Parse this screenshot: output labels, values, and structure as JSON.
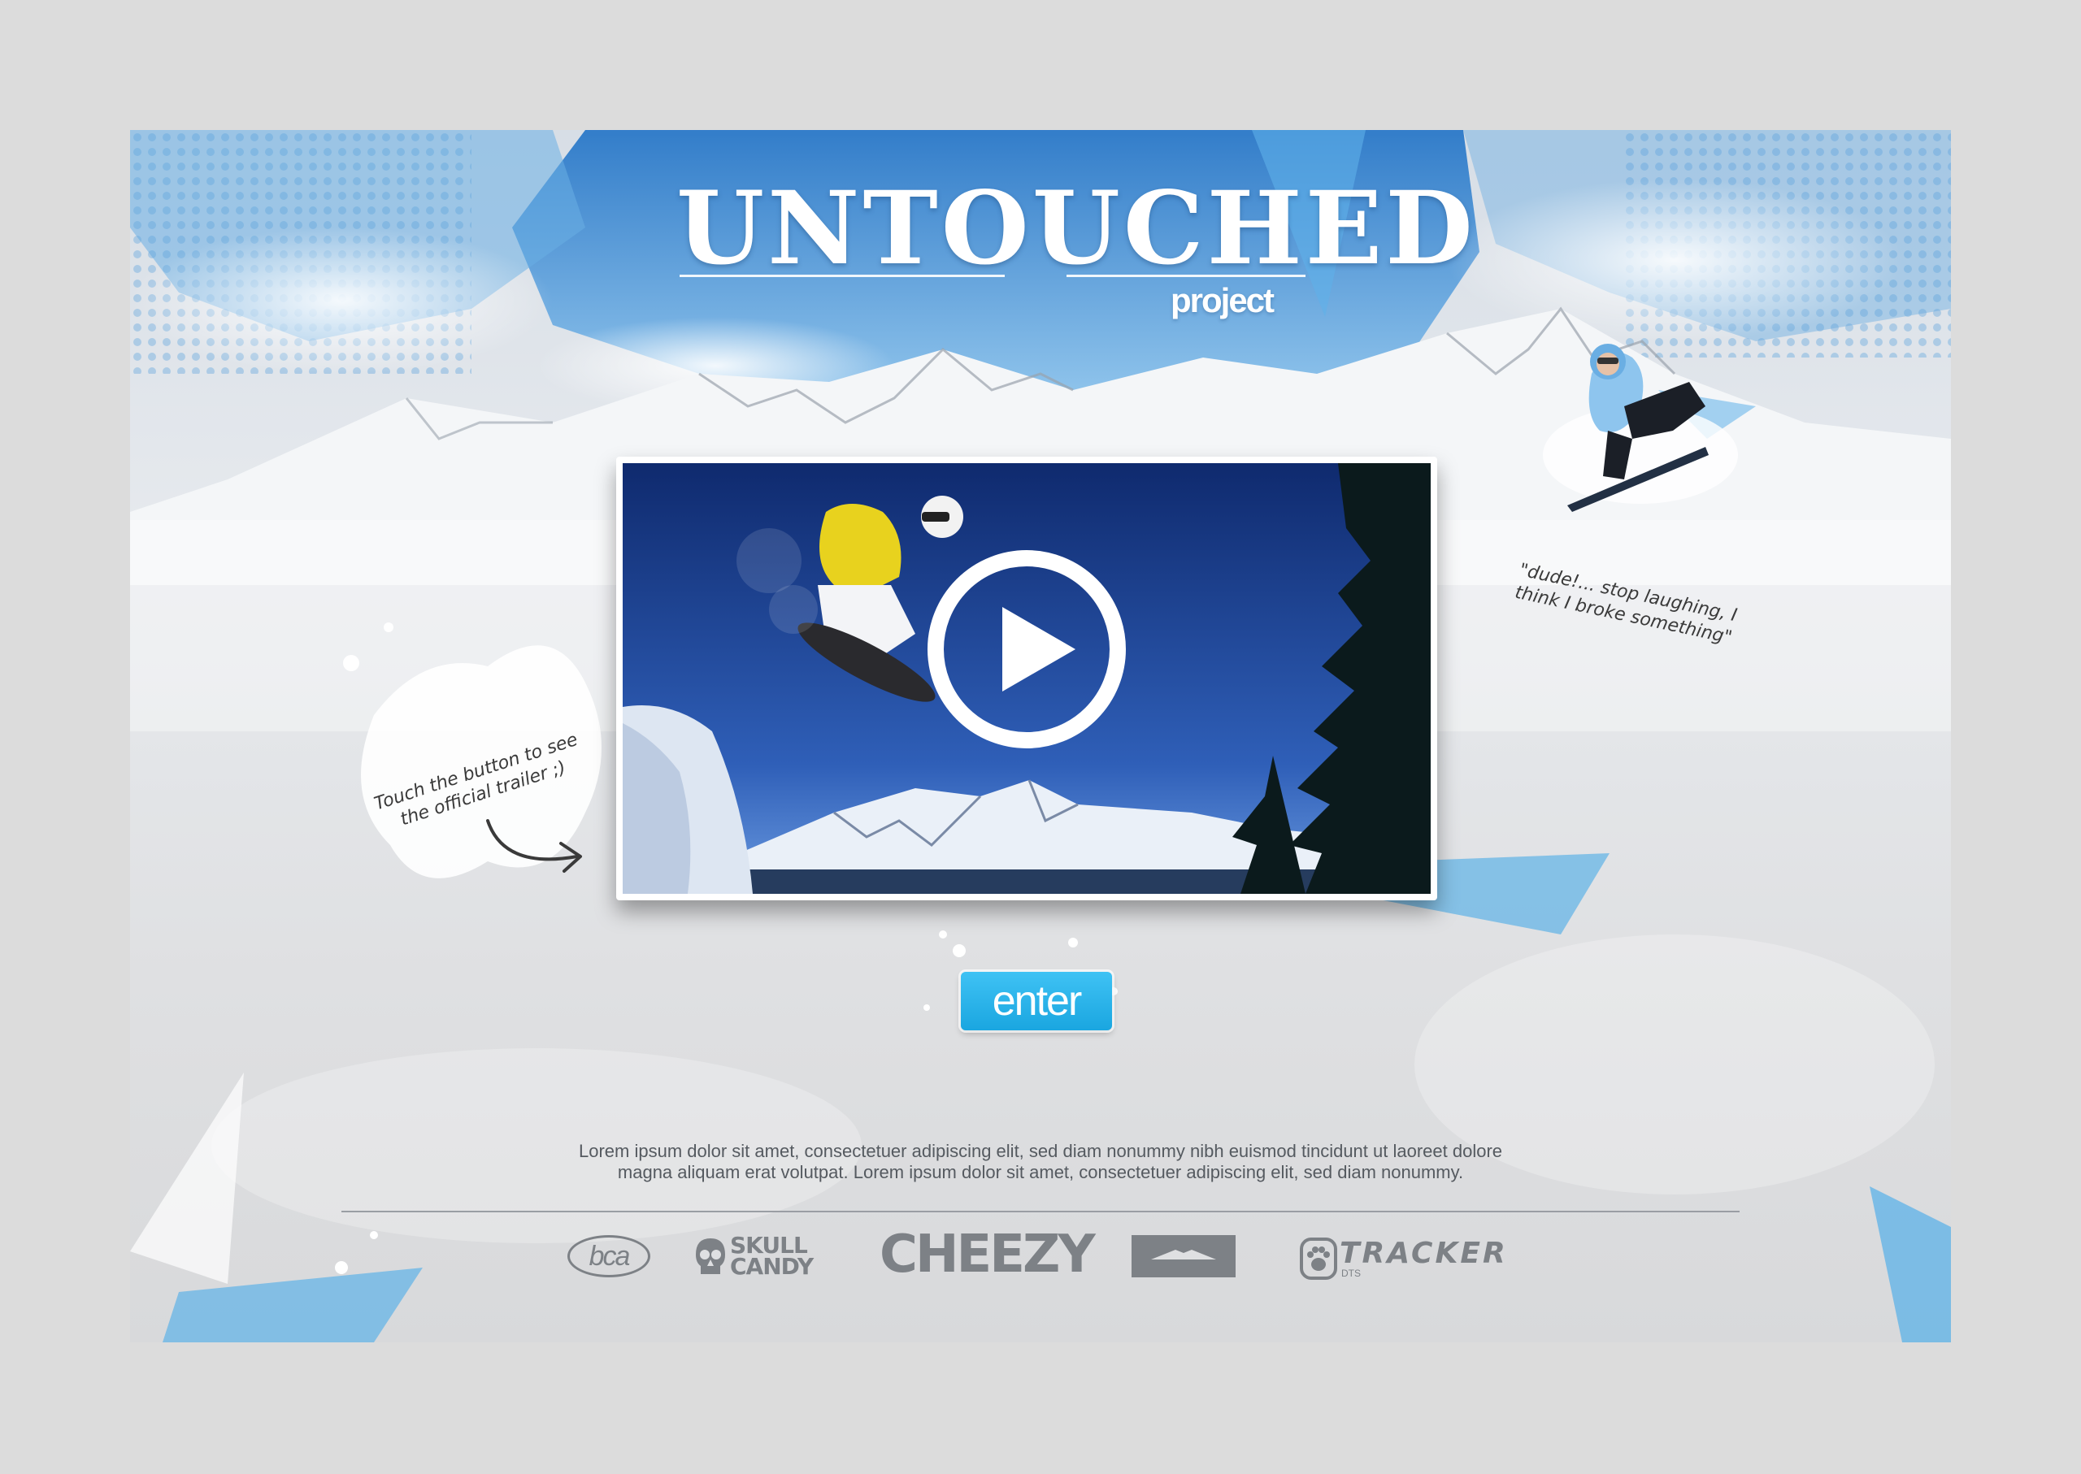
{
  "hero": {
    "title": "UNTOUCHED",
    "subtitle": "project"
  },
  "video": {
    "play_icon": "play-circle-icon",
    "thumbnail": "snowboarder-jump"
  },
  "notes": {
    "left": "Touch the button to see the official trailer ;)",
    "right": "\"dude!... stop laughing, I think I broke something\""
  },
  "cta": {
    "enter_label": "enter"
  },
  "footer": {
    "text_line1": "Lorem ipsum dolor sit amet, consectetuer adipiscing elit, sed diam nonummy nibh euismod tincidunt ut laoreet dolore",
    "text_line2": "magna aliquam erat volutpat. Lorem ipsum dolor sit amet, consectetuer adipiscing elit, sed diam nonummy."
  },
  "sponsors": {
    "bca": "bca",
    "skull_line1": "SKULL",
    "skull_line2": "CANDY",
    "cheezy": "CHEEZY",
    "tracker": "TRACKER",
    "tracker_sub": "DTS"
  },
  "colors": {
    "accent": "#1aa6e0",
    "sky": "#2f7fce",
    "background": "#dcdcdc"
  }
}
